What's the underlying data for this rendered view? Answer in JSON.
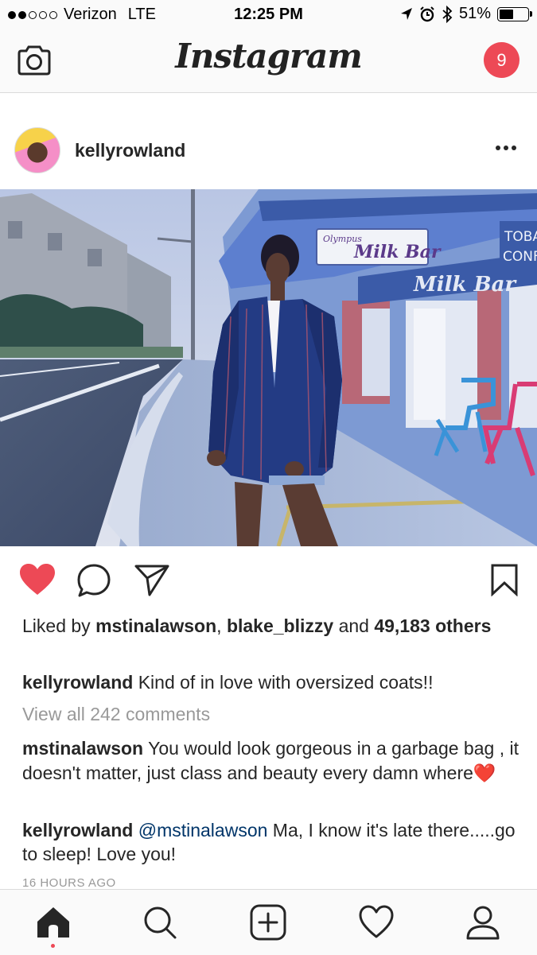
{
  "status_bar": {
    "carrier": "Verizon",
    "network": "LTE",
    "time": "12:25 PM",
    "battery": "51%",
    "battery_level": 0.51,
    "signal_bars_filled": 2,
    "signal_bars_total": 5
  },
  "navbar": {
    "logo": "Instagram",
    "notification_count": "9",
    "accent_color": "#ed4956"
  },
  "post": {
    "username": "kellyrowland",
    "liked_by_prefix": "Liked by ",
    "liked_user_1": "mstinalawson",
    "liked_separator": ", ",
    "liked_user_2": "blake_blizzy",
    "liked_and": " and ",
    "liked_others": "49,183 others",
    "caption_user": "kellyrowland",
    "caption_text": "Kind of in love with oversized coats!!",
    "view_all_comments": "View all 242 comments",
    "comments": [
      {
        "user": "mstinalawson",
        "text": "You would look gorgeous in a garbage bag , it doesn't matter,  just class and beauty every damn where",
        "emoji": "❤️"
      },
      {
        "user": "kellyrowland",
        "mention": "@mstinalawson",
        "text": "Ma, I know it's late there.....go to sleep! Love you!"
      }
    ],
    "timestamp": "16 HOURS AGO",
    "photo_signs": {
      "sign_1": "Olympus",
      "sign_2": "Milk Bar",
      "sign_3": "Milk Bar",
      "sign_4": "TOBA",
      "sign_5": "CONFE"
    }
  },
  "icons": {
    "camera": "camera-icon",
    "heart": "heart-filled-icon",
    "comment": "comment-icon",
    "share": "send-icon",
    "bookmark": "bookmark-icon",
    "home": "home-icon",
    "search": "search-icon",
    "add": "add-icon",
    "activity": "heart-outline-icon",
    "profile": "profile-icon"
  }
}
